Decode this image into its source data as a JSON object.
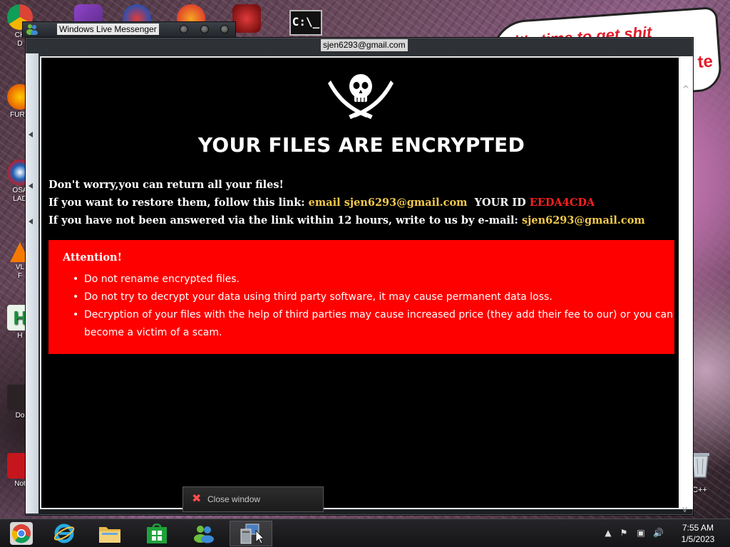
{
  "desktop": {
    "left_icons": [
      {
        "label": "CH\nD"
      },
      {
        "label": "FURR"
      },
      {
        "label": "OSA\nLAD"
      },
      {
        "label": "VL\nF"
      },
      {
        "label": "H"
      },
      {
        "label": "Do"
      },
      {
        "label": "Not"
      }
    ],
    "right_label": "n C++",
    "bubble_text": "it's time to get shit",
    "bubble_text2": "te",
    "cmd_icon_text": "C:\\_"
  },
  "messenger": {
    "title": "Windows Live Messenger"
  },
  "ransom_window": {
    "title": "sjen6293@gmail.com",
    "heading": "YOUR FILES ARE ENCRYPTED",
    "line1": "Don't worry,you can return all your files!",
    "line2_prefix": "If you want to restore them, follow this link:",
    "line2_email": "email sjen6293@gmail.com",
    "line2_id_label": "YOUR ID",
    "line2_id_value": "EEDA4CDA",
    "line3_prefix": "If you have not been answered via the link within 12 hours, write to us by e-mail:",
    "line3_email": "sjen6293@gmail.com",
    "attention": {
      "title": "Attention!",
      "items": [
        "Do not rename encrypted files.",
        "Do not try to decrypt your data using third party software, it may cause permanent data loss.",
        "Decryption of your files with the help of third parties may cause increased price (they add their fee to our) or you can become a victim of a scam."
      ]
    }
  },
  "close_popup": {
    "label": "Close window"
  },
  "taskbar": {
    "items": [
      {
        "name": "chrome"
      },
      {
        "name": "internet-explorer"
      },
      {
        "name": "file-explorer"
      },
      {
        "name": "store"
      },
      {
        "name": "windows-live-messenger"
      },
      {
        "name": "ransomware-app"
      }
    ],
    "clock_time": "7:55 AM",
    "clock_date": "1/5/2023"
  },
  "colors": {
    "attention_bg": "#ff0000",
    "email_gold": "#f2c94c",
    "id_red": "#ff1f1f"
  }
}
